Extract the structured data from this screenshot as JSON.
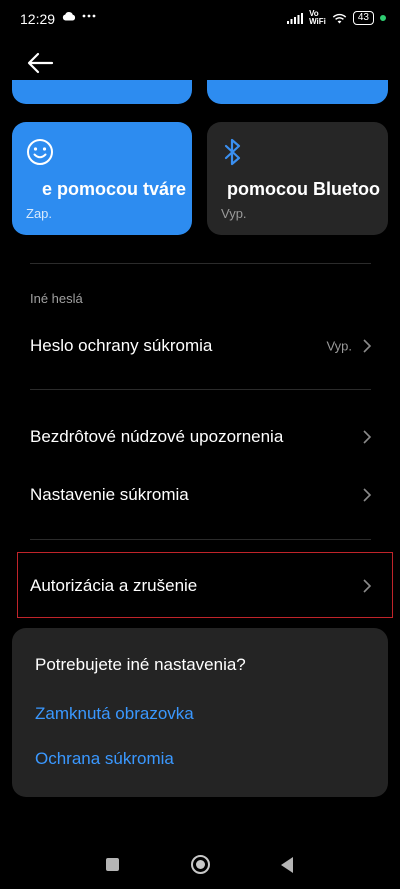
{
  "status_bar": {
    "time": "12:29",
    "left_icons": [
      "cloud-icon",
      "more-dots-icon"
    ],
    "right_icons": [
      "signal-icon",
      "volte-wifi-icon",
      "wifi-icon",
      "battery-icon"
    ],
    "volte_top": "Vo",
    "volte_bottom": "WiFi",
    "battery": "43"
  },
  "header": {
    "back_icon": "back-arrow-icon"
  },
  "unlock_cards": [
    {
      "icon": "smiley-face-icon",
      "title": "e pomocou tváre",
      "status": "Zap.",
      "accent": "#2d8cf0"
    },
    {
      "icon": "bluetooth-icon",
      "title": "pomocou Bluetoo",
      "status": "Vyp.",
      "accent": "#262626"
    }
  ],
  "section": {
    "label": "Iné heslá"
  },
  "rows": {
    "privacy_password": {
      "label": "Heslo ochrany súkromia",
      "value": "Vyp."
    },
    "wireless_alerts": {
      "label": "Bezdrôtové núdzové upozornenia"
    },
    "privacy_settings": {
      "label": "Nastavenie súkromia"
    },
    "authorization": {
      "label": "Autorizácia a zrušenie"
    }
  },
  "suggestions": {
    "title": "Potrebujete iné nastavenia?",
    "links": [
      "Zamknutá obrazovka",
      "Ochrana súkromia"
    ],
    "link_color": "#3a98ff"
  },
  "nav_bar": {
    "icons": [
      "recents-icon",
      "home-icon",
      "back-icon"
    ]
  },
  "colors": {
    "background": "#000000",
    "accent_blue": "#2d8cf0",
    "highlight_red": "#c0242a"
  }
}
